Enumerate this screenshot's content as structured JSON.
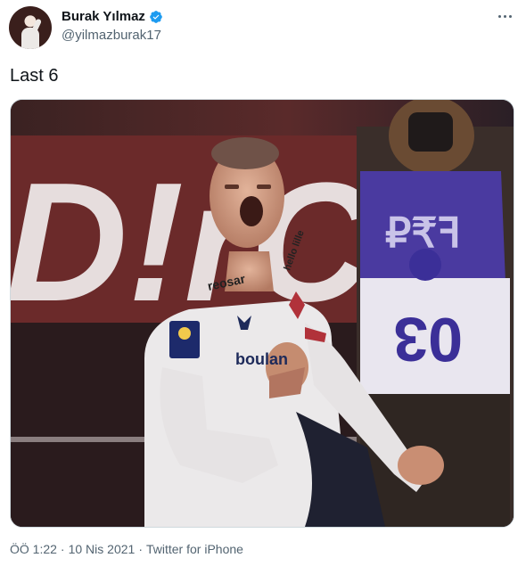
{
  "tweet": {
    "author": {
      "display_name": "Burak Yılmaz",
      "handle": "@yilmazburak17",
      "verified": true,
      "verified_icon": "verified-badge-icon",
      "verified_color": "#1d9bf0"
    },
    "text": "Last 6",
    "media": {
      "board_text": "D!rC",
      "sponsor_text": "boulan",
      "badge_text": "hello lille",
      "bib_number": "03"
    },
    "time": "ÖÖ 1:22",
    "date": "10 Nis 2021",
    "separator": "·",
    "source": "Twitter for iPhone",
    "more_icon": "more-options-icon"
  }
}
